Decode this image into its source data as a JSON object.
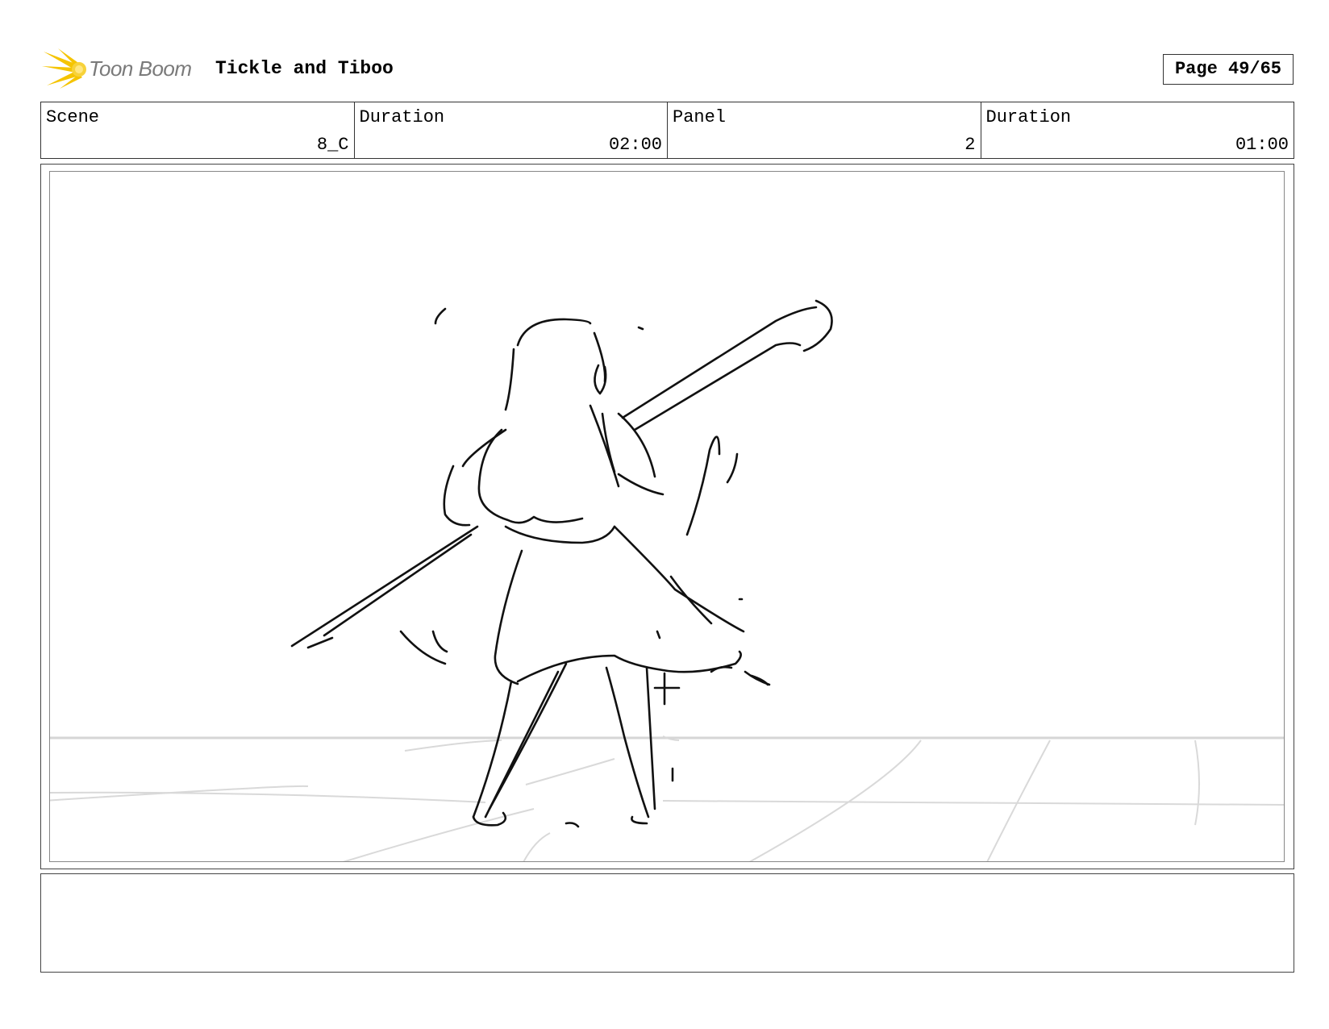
{
  "header": {
    "logo_text": "Toon Boom",
    "project_title": "Tickle and Tiboo",
    "page_label": "Page 49/65"
  },
  "info": [
    {
      "label": "Scene",
      "value": "8_C"
    },
    {
      "label": "Duration",
      "value": "02:00"
    },
    {
      "label": "Panel",
      "value": "2"
    },
    {
      "label": "Duration",
      "value": "01:00"
    }
  ],
  "panel": {
    "image": "storyboard sketch",
    "notes": ""
  },
  "colors": {
    "logo_accent": "#f5c400",
    "logo_text": "#7a7a7a",
    "border": "#333333"
  }
}
